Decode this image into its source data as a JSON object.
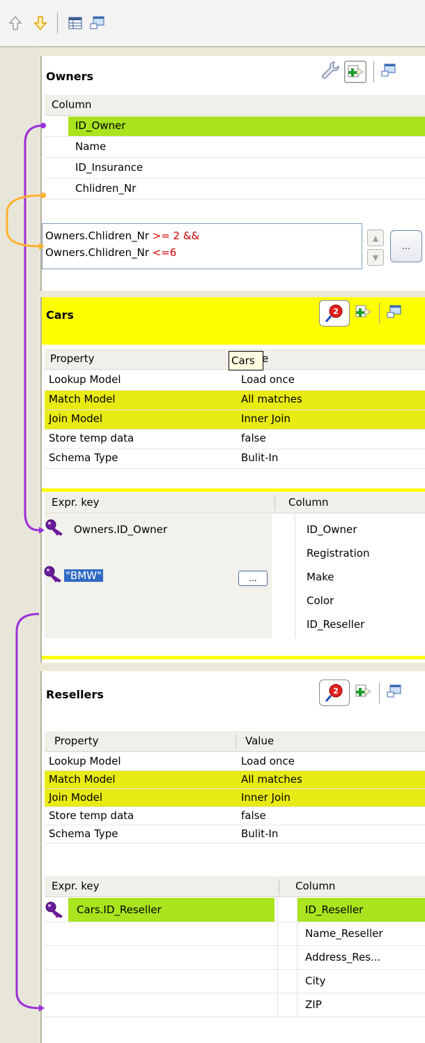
{
  "toolbar": {
    "icons": [
      "move-up-arrow-icon",
      "move-down-arrow-icon",
      "table-icon",
      "minimize-window-icon"
    ]
  },
  "owners": {
    "title": "Owners",
    "column_header": "Column",
    "columns": [
      "ID_Owner",
      "Name",
      "ID_Insurance",
      "Chlidren_Nr"
    ],
    "filter_line1": "Owners.Chlidren_Nr",
    "filter_op1": ">= 2 &&",
    "filter_line2": "Owners.Chlidren_Nr",
    "filter_op2": "<=6",
    "filter_button": "..."
  },
  "cars": {
    "title": "Cars",
    "tooltip": "Cars",
    "property_header": "Property",
    "value_header": "Value",
    "properties": [
      {
        "name": "Lookup Model",
        "value": "Load once"
      },
      {
        "name": "Match Model",
        "value": "All matches"
      },
      {
        "name": "Join Model",
        "value": "Inner Join"
      },
      {
        "name": "Store temp data",
        "value": "false"
      },
      {
        "name": "Schema Type",
        "value": "Bulit-In"
      }
    ],
    "expr_header": "Expr. key",
    "column_header": "Column",
    "expr_keys": [
      "Owners.ID_Owner",
      "\"BMW\""
    ],
    "expr_button": "...",
    "columns": [
      "ID_Owner",
      "Registration",
      "Make",
      "Color",
      "ID_Reseller"
    ]
  },
  "resellers": {
    "title": "Resellers",
    "property_header": "Property",
    "value_header": "Value",
    "properties": [
      {
        "name": "Lookup Model",
        "value": "Load once"
      },
      {
        "name": "Match Model",
        "value": "All matches"
      },
      {
        "name": "Join Model",
        "value": "Inner Join"
      },
      {
        "name": "Store temp data",
        "value": "false"
      },
      {
        "name": "Schema Type",
        "value": "Bulit-In"
      }
    ],
    "expr_header": "Expr. key",
    "column_header": "Column",
    "expr_keys": [
      "Cars.ID_Reseller"
    ],
    "columns": [
      "ID_Reseller",
      "Name_Reseller",
      "Address_Res...",
      "City",
      "ZIP"
    ]
  },
  "colors": {
    "green_highlight": "#a9e41e",
    "yellow_highlight": "#e8ea14",
    "cars_header": "#ffff00",
    "link_purple": "#9b30d9",
    "filter_orange": "#ffb22e",
    "operator_red": "#d20000"
  }
}
